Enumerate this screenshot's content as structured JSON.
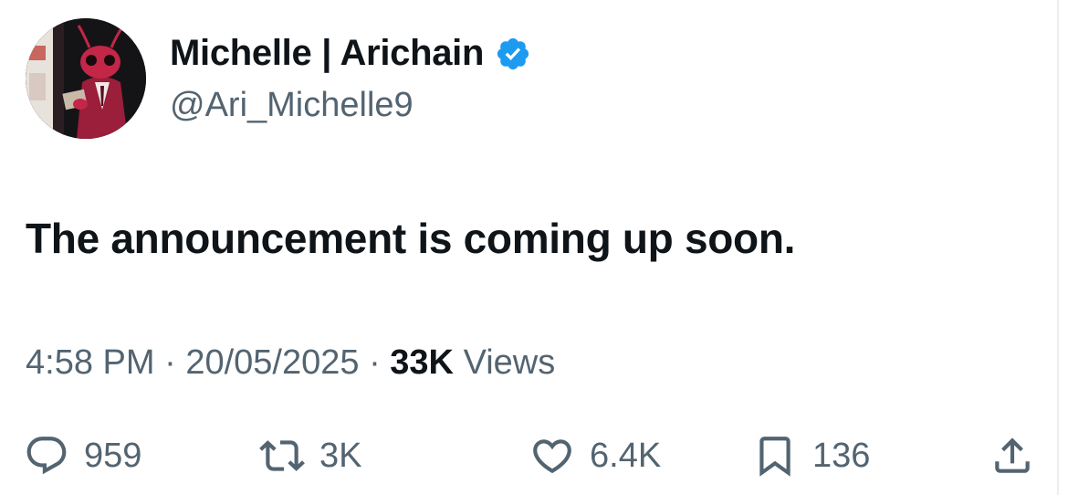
{
  "author": {
    "display_name": "Michelle | Arichain",
    "handle": "@Ari_Michelle9",
    "verified": true,
    "avatar_icon": "ant-character-avatar"
  },
  "tweet": {
    "text": "The announcement is coming up soon.",
    "time": "4:58 PM",
    "date": "20/05/2025",
    "separator": "·",
    "views_count": "33K",
    "views_label": "Views"
  },
  "actions": {
    "replies": "959",
    "retweets": "3K",
    "likes": "6.4K",
    "bookmarks": "136"
  },
  "colors": {
    "text_primary": "#0f1419",
    "text_secondary": "#536471",
    "verified_blue": "#1d9bf0"
  }
}
